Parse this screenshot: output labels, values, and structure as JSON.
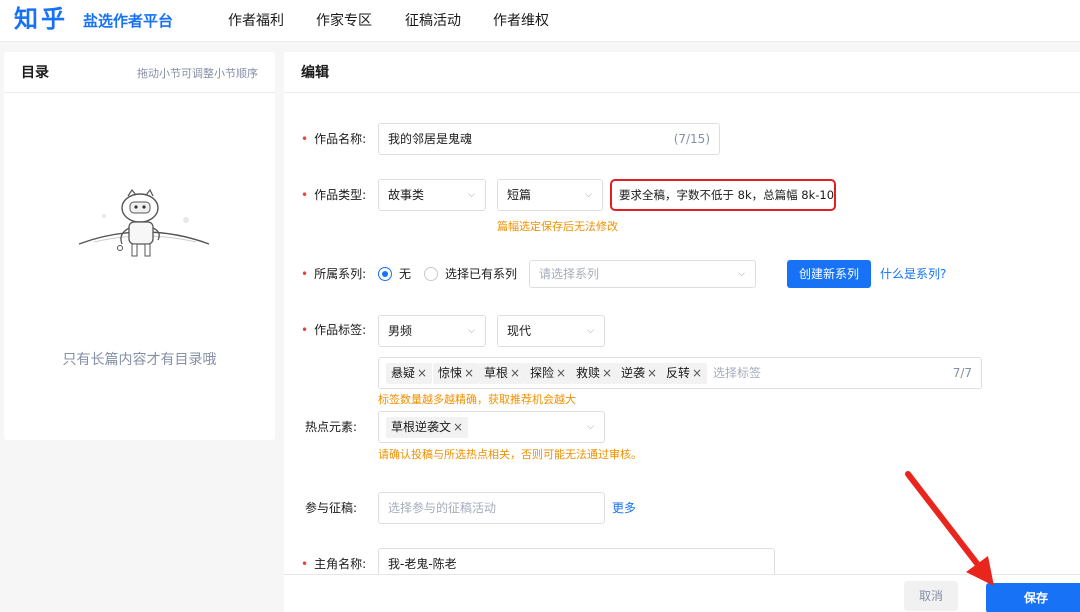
{
  "header": {
    "logo": "知乎",
    "subtitle": "盐选作者平台",
    "nav": [
      "作者福利",
      "作家专区",
      "征稿活动",
      "作者维权"
    ]
  },
  "toc": {
    "title": "目录",
    "hint": "拖动小节可调整小节顺序",
    "empty_text": "只有长篇内容才有目录哦"
  },
  "editor": {
    "title": "编辑",
    "work_name": {
      "label": "作品名称:",
      "value": "我的邻居是鬼魂",
      "counter": "(7/15)"
    },
    "work_type": {
      "label": "作品类型:",
      "category": "故事类",
      "length": "短篇",
      "requirement": "要求全稿，字数不低于 8k，总篇幅 8k-10w",
      "tip": "篇幅选定保存后无法修改"
    },
    "series": {
      "label": "所属系列:",
      "option_none": "无",
      "option_existing": "选择已有系列",
      "placeholder": "请选择系列",
      "create_button": "创建新系列",
      "help_link": "什么是系列?"
    },
    "tags": {
      "label": "作品标签:",
      "channel": "男频",
      "genre": "现代",
      "items": [
        "悬疑",
        "惊悚",
        "草根",
        "探险",
        "救赎",
        "逆袭",
        "反转"
      ],
      "placeholder": "选择标签",
      "counter": "7/7",
      "tip": "标签数量越多越精确，获取推荐机会越大"
    },
    "hot_elements": {
      "label": "热点元素:",
      "items": [
        "草根逆袭文"
      ],
      "tip": "请确认投稿与所选热点相关，否则可能无法通过审核。"
    },
    "contest": {
      "label": "参与征稿:",
      "placeholder": "选择参与的征稿活动",
      "more_link": "更多"
    },
    "protagonist": {
      "label": "主角名称:",
      "value": "我-老鬼-陈老"
    }
  },
  "footer": {
    "cancel": "取消",
    "save": "保存"
  },
  "colors": {
    "brand": "#1772f6",
    "required_mark": "#f1403c",
    "warning_tip": "#f09000",
    "highlight_border": "#e02020"
  }
}
